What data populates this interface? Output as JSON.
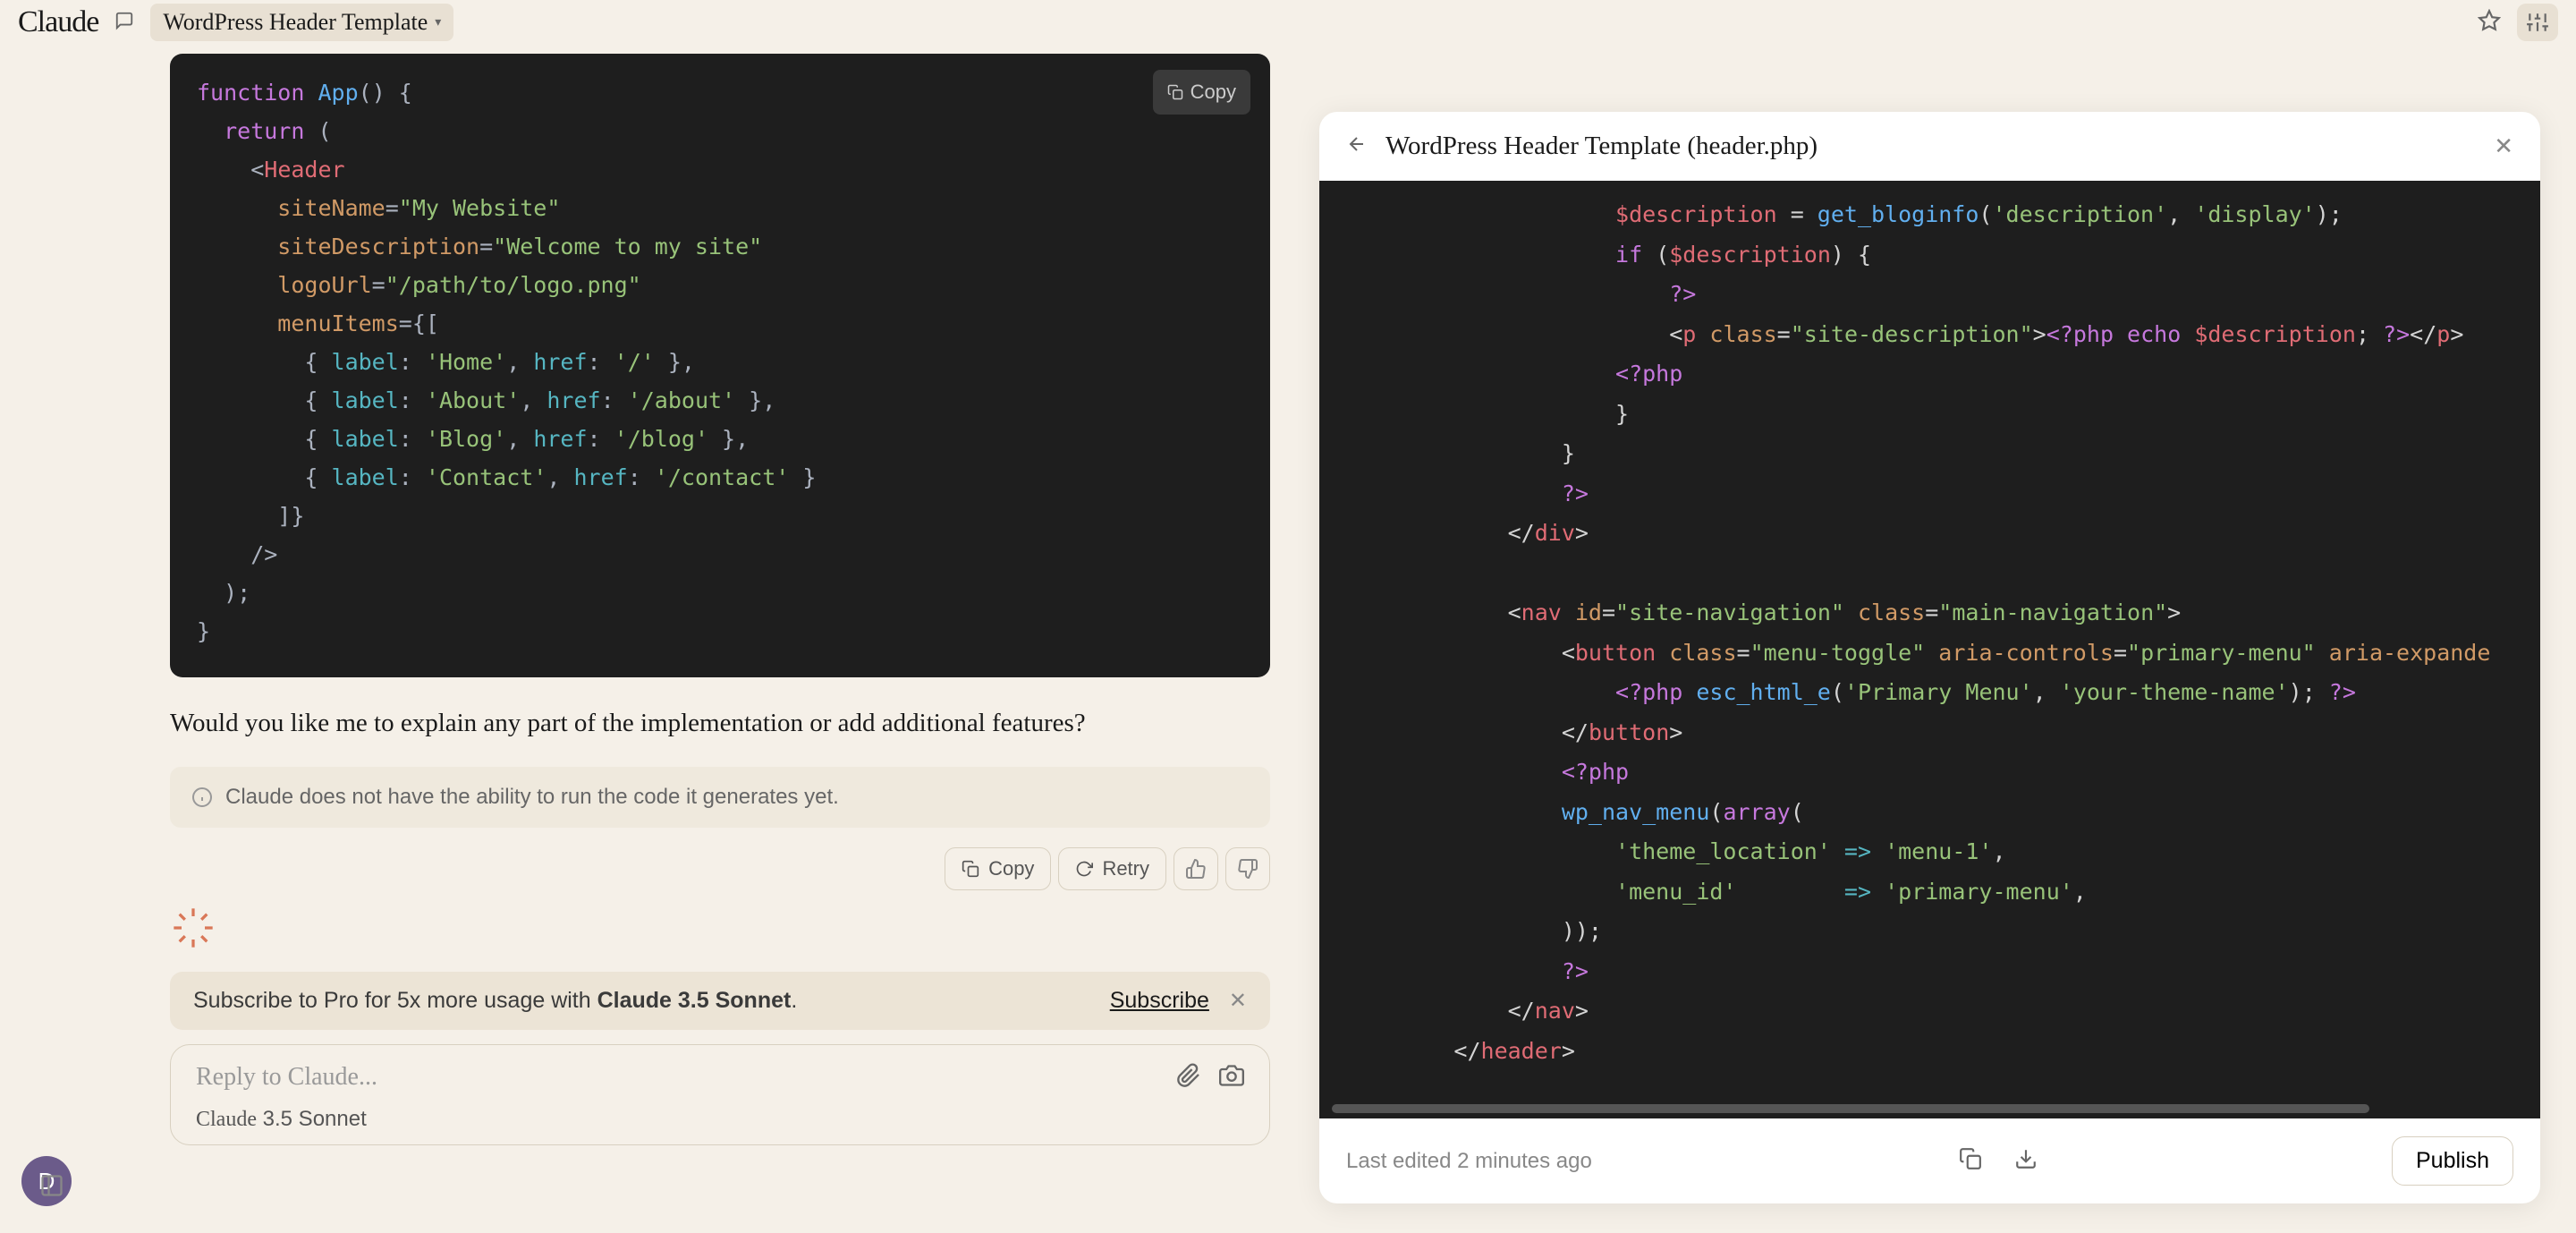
{
  "topbar": {
    "logo": "Claude",
    "doc_title": "WordPress Header Template"
  },
  "left_code": {
    "copy_label": "Copy",
    "lines": {
      "l1a": "function",
      "l1b": " App",
      "l1c": "() {",
      "l2a": "  return",
      "l2b": " (",
      "l3a": "    <",
      "l3b": "Header",
      "l4a": "      siteName",
      "l4b": "=",
      "l4c": "\"My Website\"",
      "l5a": "      siteDescription",
      "l5b": "=",
      "l5c": "\"Welcome to my site\"",
      "l6a": "      logoUrl",
      "l6b": "=",
      "l6c": "\"/path/to/logo.png\"",
      "l7a": "      menuItems",
      "l7b": "=",
      "l7c": "{[",
      "l8a": "        { ",
      "l8b": "label",
      "l8c": ": ",
      "l8d": "'Home'",
      "l8e": ", ",
      "l8f": "href",
      "l8g": ": ",
      "l8h": "'/'",
      "l8i": " },",
      "l9a": "        { ",
      "l9b": "label",
      "l9c": ": ",
      "l9d": "'About'",
      "l9e": ", ",
      "l9f": "href",
      "l9g": ": ",
      "l9h": "'/about'",
      "l9i": " },",
      "l10a": "        { ",
      "l10b": "label",
      "l10c": ": ",
      "l10d": "'Blog'",
      "l10e": ", ",
      "l10f": "href",
      "l10g": ": ",
      "l10h": "'/blog'",
      "l10i": " },",
      "l11a": "        { ",
      "l11b": "label",
      "l11c": ": ",
      "l11d": "'Contact'",
      "l11e": ", ",
      "l11f": "href",
      "l11g": ": ",
      "l11h": "'/contact'",
      "l11i": " }",
      "l12": "      ]}",
      "l13": "    />",
      "l14": "  );",
      "l15": "}"
    }
  },
  "followup_text": "Would you like me to explain any part of the implementation or add additional features?",
  "note_text": "Claude does not have the ability to run the code it generates yet.",
  "actions": {
    "copy": "Copy",
    "retry": "Retry"
  },
  "subscribe": {
    "msg_pre": "Subscribe to Pro for 5x more usage with ",
    "msg_bold": "Claude 3.5 Sonnet",
    "msg_post": ".",
    "link": "Subscribe"
  },
  "reply": {
    "placeholder": "Reply to Claude...",
    "model_brand": "Claude",
    "model_ver": " 3.5 Sonnet"
  },
  "artifact": {
    "title": "WordPress Header Template (header.php)",
    "last_edited": "Last edited 2 minutes ago",
    "publish": "Publish",
    "code": {
      "l1a": "                    $description",
      "l1b": " = ",
      "l1c": "get_bloginfo",
      "l1d": "(",
      "l1e": "'description'",
      "l1f": ", ",
      "l1g": "'display'",
      "l1h": ");",
      "l2a": "                    if",
      "l2b": " (",
      "l2c": "$description",
      "l2d": ") {",
      "l3": "                        ?>",
      "l4a": "                        <",
      "l4b": "p",
      "l4c": " class",
      "l4d": "=",
      "l4e": "\"site-description\"",
      "l4f": ">",
      "l4g": "<?php",
      "l4h": " echo",
      "l4i": " $description",
      "l4j": "; ",
      "l4k": "?>",
      "l4l": "</",
      "l4m": "p",
      "l4n": ">",
      "l5": "                    <?php",
      "l6": "                    }",
      "l7": "                }",
      "l8": "                ?>",
      "l9a": "            </",
      "l9b": "div",
      "l9c": ">",
      "l10": "",
      "l11a": "            <",
      "l11b": "nav",
      "l11c": " id",
      "l11d": "=",
      "l11e": "\"site-navigation\"",
      "l11f": " class",
      "l11g": "=",
      "l11h": "\"main-navigation\"",
      "l11i": ">",
      "l12a": "                <",
      "l12b": "button",
      "l12c": " class",
      "l12d": "=",
      "l12e": "\"menu-toggle\"",
      "l12f": " aria-controls",
      "l12g": "=",
      "l12h": "\"primary-menu\"",
      "l12i": " aria-expande",
      "l13a": "                    <?php",
      "l13b": " esc_html_e",
      "l13c": "(",
      "l13d": "'Primary Menu'",
      "l13e": ", ",
      "l13f": "'your-theme-name'",
      "l13g": "); ",
      "l13h": "?>",
      "l14a": "                </",
      "l14b": "button",
      "l14c": ">",
      "l15": "                <?php",
      "l16a": "                wp_nav_menu",
      "l16b": "(",
      "l16c": "array",
      "l16d": "(",
      "l17a": "                    'theme_location'",
      "l17b": " => ",
      "l17c": "'menu-1'",
      "l17d": ",",
      "l18a": "                    'menu_id'",
      "l18b": "        => ",
      "l18c": "'primary-menu'",
      "l18d": ",",
      "l19": "                ));",
      "l20": "                ?>",
      "l21a": "            </",
      "l21b": "nav",
      "l21c": ">",
      "l22a": "        </",
      "l22b": "header",
      "l22c": ">"
    }
  },
  "avatar_initial": "D"
}
